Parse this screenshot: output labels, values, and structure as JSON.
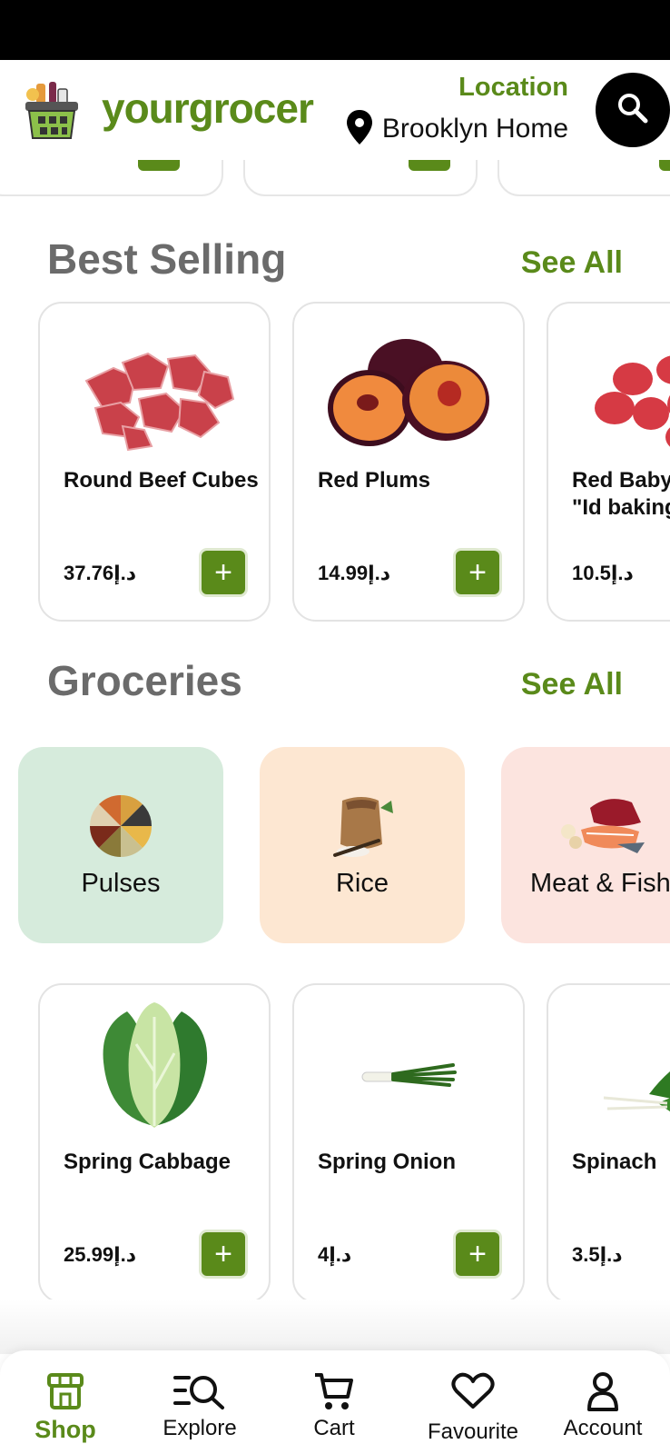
{
  "header": {
    "brand": "yourgrocer",
    "location_label": "Location",
    "location_name": "Brooklyn Home"
  },
  "best_selling": {
    "title": "Best Selling",
    "see_all": "See All",
    "items": [
      {
        "name": "Round Beef Cubes",
        "price": "د.إ37.76",
        "icon": "beef-cubes-image"
      },
      {
        "name": "Red Plums",
        "price": "د.إ14.99",
        "icon": "plums-image"
      },
      {
        "name": "Red Baby Potato \"Id baking\"",
        "price": "د.إ10.5",
        "icon": "potatoes-image"
      }
    ]
  },
  "groceries": {
    "title": "Groceries",
    "see_all": "See All",
    "categories": [
      {
        "label": "Pulses",
        "color": "#d6ebdc",
        "icon": "pulses-image"
      },
      {
        "label": "Rice",
        "color": "#fde7d2",
        "icon": "rice-sack-image"
      },
      {
        "label": "Meat & Fish",
        "color": "#fce4df",
        "icon": "meat-fish-image"
      }
    ],
    "items": [
      {
        "name": "Spring Cabbage",
        "price": "د.إ25.99",
        "icon": "cabbage-image"
      },
      {
        "name": "Spring Onion",
        "price": "د.إ4",
        "icon": "onion-image"
      },
      {
        "name": "Spinach",
        "price": "د.إ3.5",
        "icon": "spinach-image"
      }
    ]
  },
  "nav": {
    "shop": "Shop",
    "explore": "Explore",
    "cart": "Cart",
    "favourite": "Favourite",
    "account": "Account",
    "add_symbol": "+"
  },
  "colors": {
    "accent": "#5a8a1a",
    "title_gray": "#6b6b6b"
  }
}
